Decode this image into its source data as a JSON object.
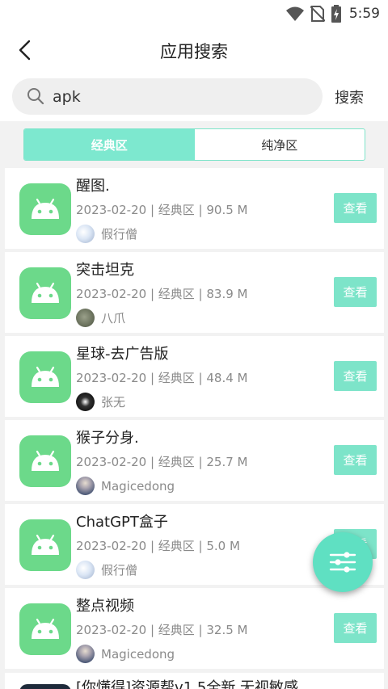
{
  "status": {
    "time": "5:59"
  },
  "header": {
    "title": "应用搜索"
  },
  "search": {
    "value": "apk",
    "button_label": "搜索"
  },
  "tabs": [
    {
      "label": "经典区",
      "active": true
    },
    {
      "label": "纯净区",
      "active": false
    }
  ],
  "apps": [
    {
      "name": "醒图.",
      "meta": "2023-02-20 | 经典区 | 90.5 M",
      "author": "假行僧",
      "button": "查看"
    },
    {
      "name": "突击坦克",
      "meta": "2023-02-20 | 经典区 | 83.9 M",
      "author": "八爪",
      "button": "查看"
    },
    {
      "name": "星球-去广告版",
      "meta": "2023-02-20 | 经典区 | 48.4 M",
      "author": "张无",
      "button": "查看"
    },
    {
      "name": "猴子分身.",
      "meta": "2023-02-20 | 经典区 | 25.7 M",
      "author": "Magicedong",
      "button": "查看"
    },
    {
      "name": "ChatGPT盒子",
      "meta": "2023-02-20 | 经典区 | 5.0 M",
      "author": "假行僧",
      "button": "查看"
    },
    {
      "name": "整点视频",
      "meta": "2023-02-20 | 经典区 | 32.5 M",
      "author": "Magicedong",
      "button": "查看"
    }
  ],
  "partial_app": {
    "name": "[你懂得]资源帮v1.5全新 无视敏感"
  },
  "colors": {
    "accent": "#7de4c9",
    "app_icon": "#6cd98a",
    "fab": "#5fe0c2"
  },
  "icons": [
    "wifi-icon",
    "no-sim-icon",
    "battery-icon",
    "back-arrow-icon",
    "search-icon",
    "android-icon",
    "filter-icon"
  ]
}
